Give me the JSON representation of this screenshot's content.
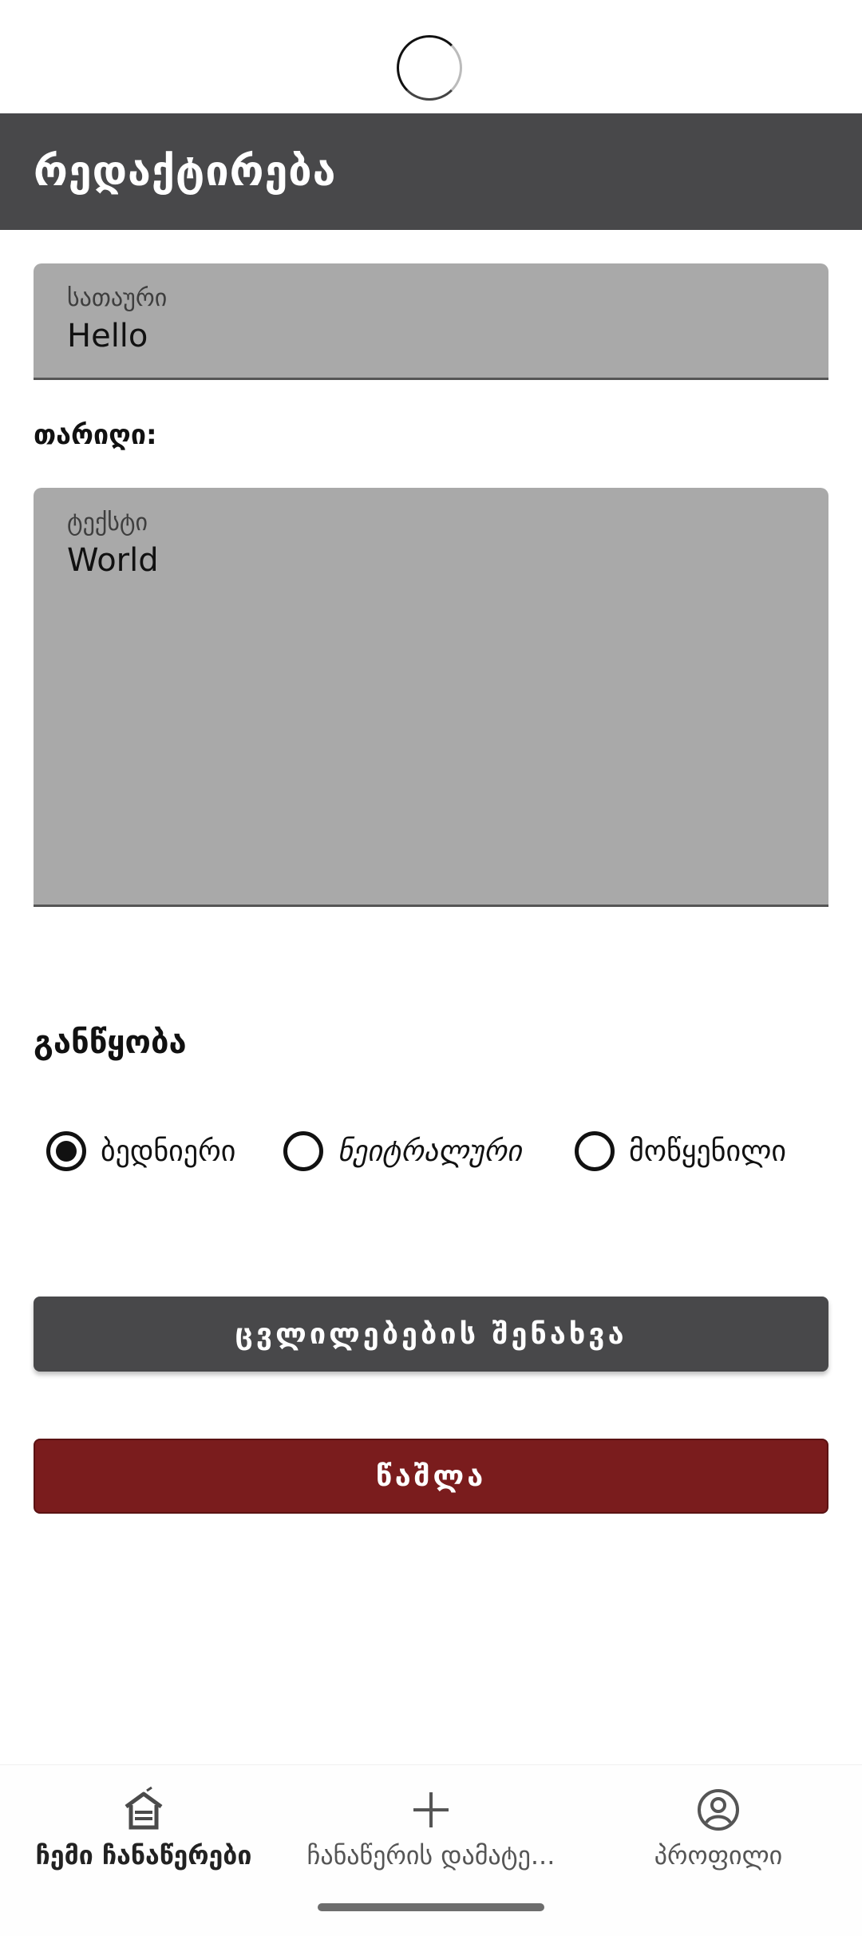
{
  "app_bar": {
    "title": "რედაქტირება"
  },
  "title_field": {
    "label": "სათაური",
    "value": "Hello"
  },
  "date": {
    "label": "თარიღი:"
  },
  "text_field": {
    "label": "ტექსტი",
    "value": "World"
  },
  "mood": {
    "label": "განწყობა",
    "options": [
      {
        "label": "ბედნიერი",
        "selected": true
      },
      {
        "label": "ნეიტრალური",
        "selected": false
      },
      {
        "label": "მოწყენილი",
        "selected": false
      }
    ]
  },
  "buttons": {
    "save": "ცვლილებების შენახვა",
    "delete": "წაშლა"
  },
  "bottom_nav": {
    "items": [
      {
        "label": "ჩემი ჩანაწერები",
        "icon": "home-icon",
        "active": true
      },
      {
        "label": "ჩანაწერის დამატე...",
        "icon": "plus-icon",
        "active": false
      },
      {
        "label": "პროფილი",
        "icon": "account-circle-icon",
        "active": false
      }
    ]
  },
  "colors": {
    "app_bar": "#48484a",
    "field_bg": "#a9a9a9",
    "delete_button": "#7a1c1d",
    "save_button": "#48484a"
  }
}
